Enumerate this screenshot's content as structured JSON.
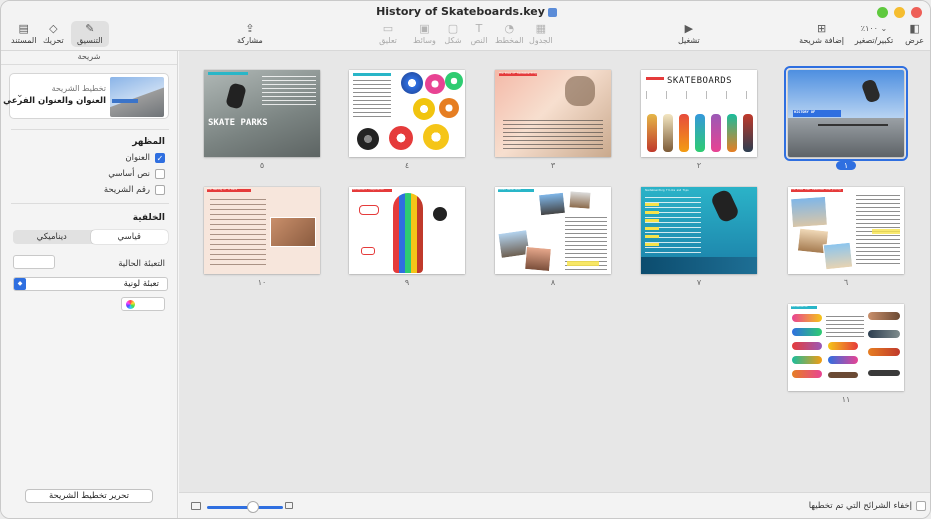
{
  "window": {
    "title": "History of Skateboards.key"
  },
  "toolbar": {
    "view": "عرض",
    "zoom": "٪١٠٠",
    "zoom_label": "تكبير/تصغير",
    "add_slide": "إضافة شريحة",
    "play": "تشغيل",
    "table": "الجدول",
    "chart": "المخطط",
    "text": "النص",
    "shape": "شكل",
    "media": "وسائط",
    "comment": "تعليق",
    "share": "مشاركة",
    "format": "التنسيق",
    "animate": "تحريك",
    "document": "المستند"
  },
  "sidebar": {
    "header": "شريحة",
    "layout_label": "تخطيط الشريحة",
    "layout_name": "العنوان والعنوان الفرعي",
    "appearance_title": "المظهر",
    "checkbox_title": "العنوان",
    "checkbox_body": "نص أساسي",
    "checkbox_slide_number": "رقم الشريحة",
    "background_title": "الخلفية",
    "seg_standard": "قياسي",
    "seg_dynamic": "ديناميكي",
    "current_fill": "التعبئة الحالية",
    "fill_type": "تعبئة لونية",
    "edit_layout": "تحرير تخطيط الشريحة"
  },
  "slides": [
    {
      "number": "١",
      "title": "HISTORY OF"
    },
    {
      "number": "٢",
      "title": "SKATEBOARDS"
    },
    {
      "number": "٣",
      "title": "The Rise of Skateboarding"
    },
    {
      "number": "٤",
      "title": ""
    },
    {
      "number": "٥",
      "title": "SKATE PARKS"
    },
    {
      "number": "٦",
      "title": "The Rise that Launched Everything"
    },
    {
      "number": "٧",
      "title": "Skateboarding Tricks and Tips"
    },
    {
      "number": "٨",
      "title": "Mixed Materials"
    },
    {
      "number": "٩",
      "title": "Skateboard Components"
    },
    {
      "number": "١٠",
      "title": "The Making of a Deck"
    },
    {
      "number": "١١",
      "title": "Skateboards"
    }
  ],
  "footer": {
    "hide_skipped": "إخفاء الشرائح التي تم تخطيها",
    "zoom_fraction": 0.6
  },
  "colors": {
    "accent": "#2f6fe0",
    "selection": "#2f6fe0"
  }
}
